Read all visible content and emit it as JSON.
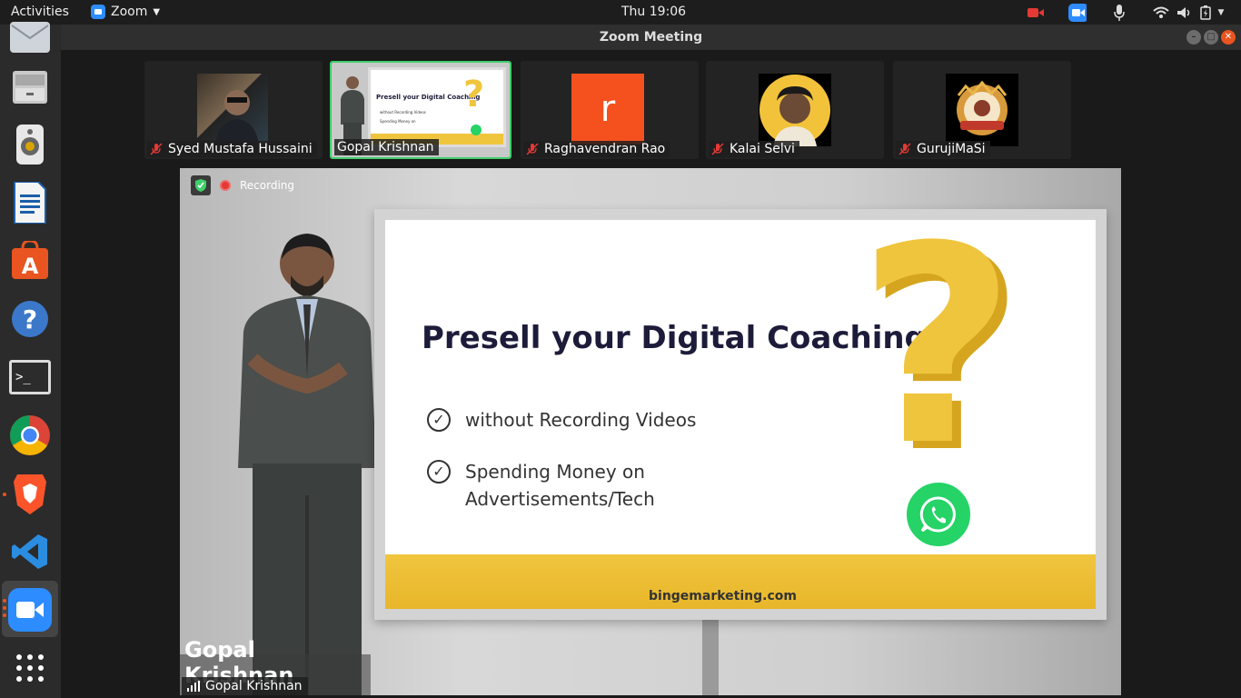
{
  "topbar": {
    "activities": "Activities",
    "app_name": "Zoom",
    "clock": "Thu 19:06"
  },
  "window": {
    "title": "Zoom Meeting"
  },
  "participants": [
    {
      "name": "Syed Mustafa Hussaini",
      "muted": true
    },
    {
      "name": "Gopal Krishnan",
      "muted": false,
      "active": true
    },
    {
      "name": "Raghavendran Rao",
      "muted": true,
      "avatar_letter": "r",
      "avatar_color": "#f4511e"
    },
    {
      "name": "Kalai Selvi",
      "muted": true
    },
    {
      "name": "GurujiMaSi",
      "muted": true
    }
  ],
  "main_video": {
    "recording_label": "Recording",
    "speaker_name": "Gopal Krishnan",
    "lower_third": "Gopal Krishnan",
    "slide": {
      "title": "Presell your Digital Coaching",
      "bullet1": "without Recording Videos",
      "bullet2_line1": "Spending Money on",
      "bullet2_line2": "Advertisements/Tech",
      "url": "bingemarketing.com"
    }
  },
  "colors": {
    "accent": "#2d8cff",
    "active_border": "#3fcf6b",
    "muted_red": "#e53935",
    "ubuntu_orange": "#e95420"
  }
}
